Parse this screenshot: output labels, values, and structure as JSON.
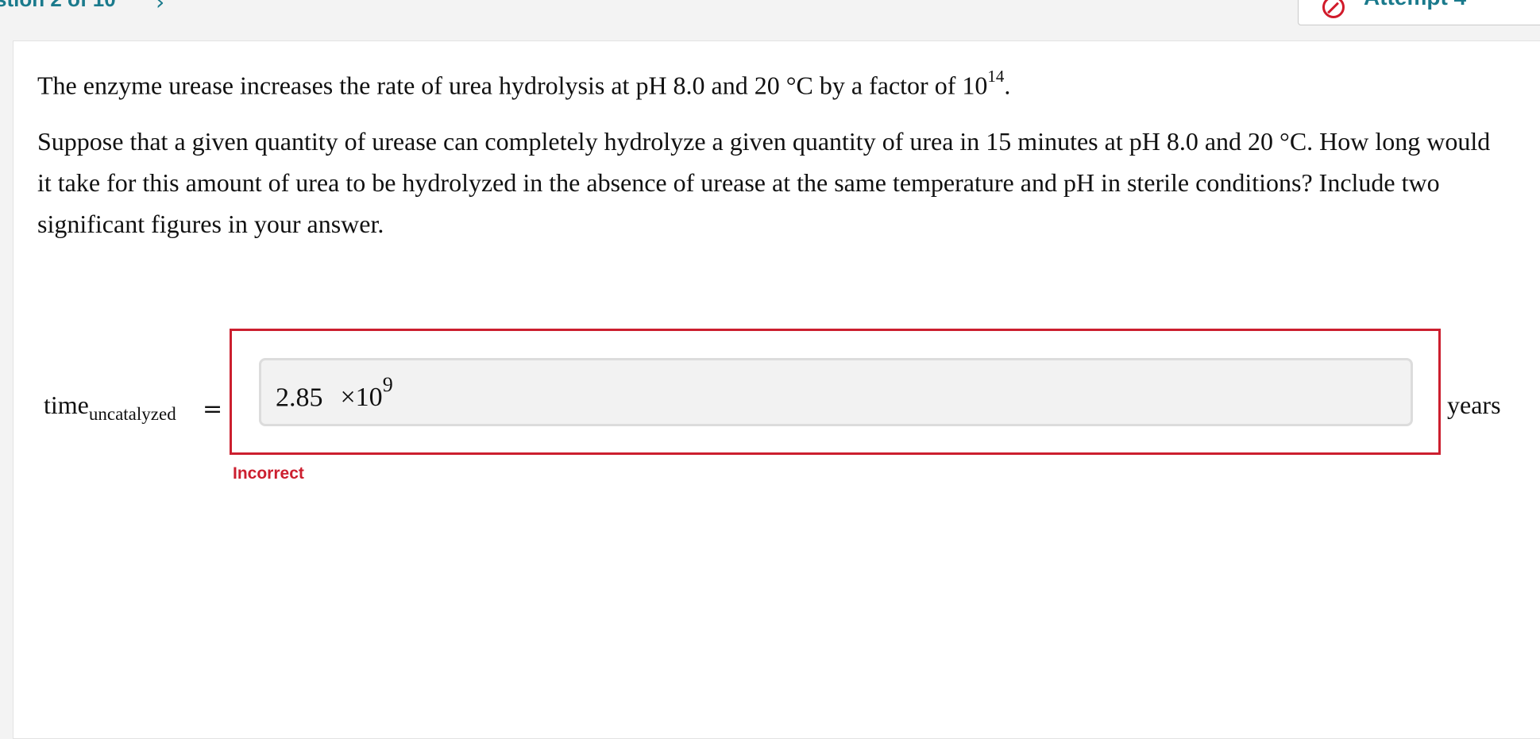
{
  "header": {
    "question_nav": "stion 2 of 10",
    "next_icon": "chevron-right-icon",
    "attempt_label": "Attempt 4",
    "attempt_icon": "prohibited-icon",
    "attempt_caret_icon": "chevron-down-icon"
  },
  "question": {
    "p1_text": "The enzyme urease increases the rate of urea hydrolysis at pH 8.0 and 20 °C by a factor of 10",
    "p1_exponent": "14",
    "p1_end": ".",
    "p2_text": "Suppose that a given quantity of urease can completely hydrolyze a given quantity of urea in 15 minutes at pH 8.0 and 20 °C. How long would it take for this amount of urea to be hydrolyzed in the absence of urease at the same temperature and pH in sterile conditions? Include two significant figures in your answer."
  },
  "answer": {
    "label_main": "time",
    "label_sub": "uncatalyzed",
    "equals": "=",
    "value": "2.85",
    "times_base": "×10",
    "exponent": "9",
    "units": "years",
    "feedback": "Incorrect"
  },
  "colors": {
    "accent": "#1a7a8c",
    "error": "#cc1f2f"
  }
}
